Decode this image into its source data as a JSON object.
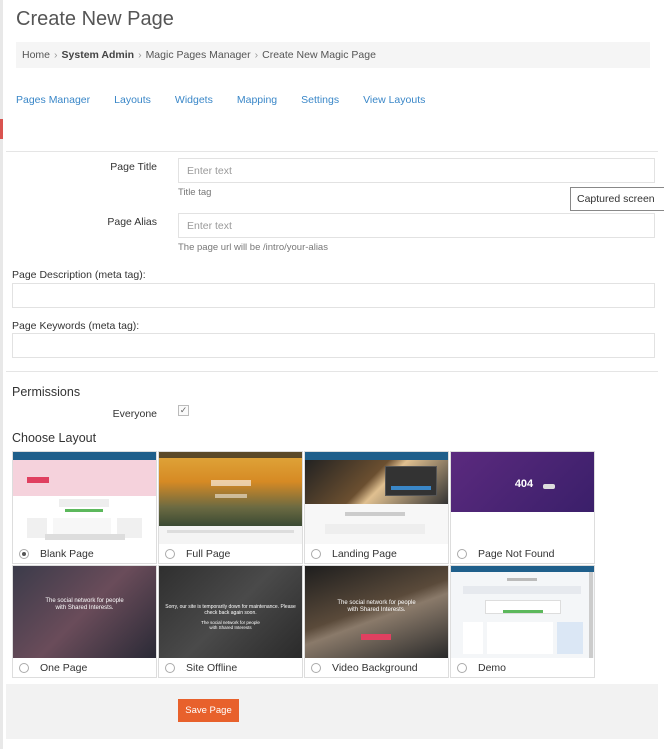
{
  "page": {
    "title": "Create New Page"
  },
  "breadcrumb": {
    "items": [
      "Home",
      "System Admin",
      "Magic Pages Manager",
      "Create New Magic Page"
    ]
  },
  "tabs": [
    "Pages Manager",
    "Layouts",
    "Widgets",
    "Mapping",
    "Settings",
    "View Layouts"
  ],
  "form": {
    "page_title_label": "Page Title",
    "page_title_placeholder": "Enter text",
    "page_title_help": "Title tag",
    "page_alias_label": "Page Alias",
    "page_alias_placeholder": "Enter text",
    "page_alias_help": "The page url will be /intro/your-alias",
    "description_label": "Page Description (meta tag):",
    "keywords_label": "Page Keywords (meta tag):"
  },
  "tooltip": {
    "text": "Captured screen"
  },
  "permissions": {
    "title": "Permissions",
    "everyone_label": "Everyone",
    "everyone_checked": true
  },
  "layouts": {
    "title": "Choose Layout",
    "selected": "Blank Page",
    "items": [
      {
        "label": "Blank Page"
      },
      {
        "label": "Full Page"
      },
      {
        "label": "Landing Page"
      },
      {
        "label": "Page Not Found"
      },
      {
        "label": "One Page"
      },
      {
        "label": "Site Offline"
      },
      {
        "label": "Video Background"
      },
      {
        "label": "Demo"
      }
    ]
  },
  "thumb_text": {
    "not_found_code": "404",
    "one_page_headline": "The social network for people with Shared Interests.",
    "offline_message": "Sorry, our site is temporarily down for maintenance. Please check back again soon.",
    "offline_sub": "The social network for people with Shared Interests",
    "video_headline": "The social network for people with Shared Interests."
  },
  "actions": {
    "save_label": "Save Page"
  },
  "colors": {
    "accent": "#3a87c8",
    "save_button": "#e8612c",
    "thumb_header": "#1f5f8b"
  }
}
